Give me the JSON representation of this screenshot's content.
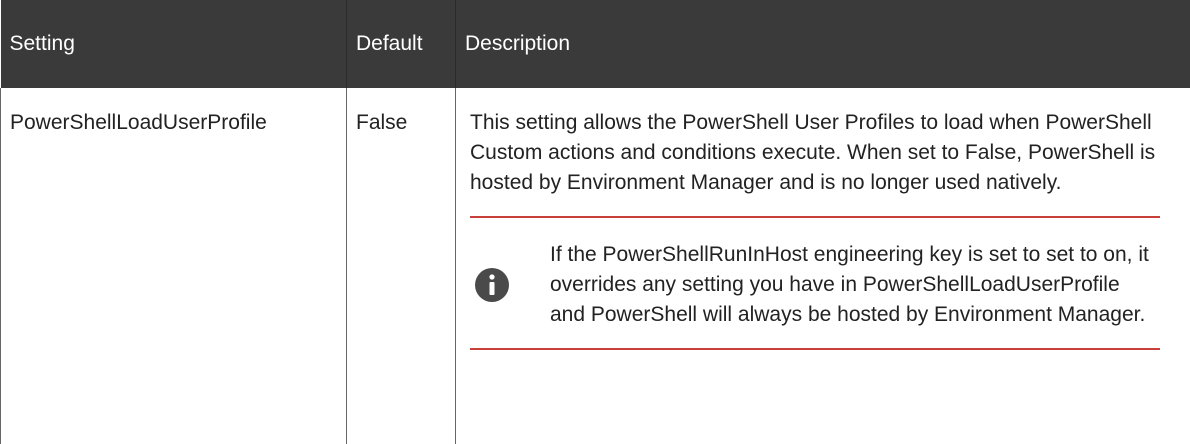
{
  "table": {
    "headers": {
      "setting": "Setting",
      "default": "Default",
      "description": "Description"
    },
    "row": {
      "setting": "PowerShellLoadUserProfile",
      "default": "False",
      "description": "This setting allows the PowerShell User Profiles to load when PowerShell Custom actions and conditions execute. When set to False, PowerShell is hosted by Environment Manager and is no longer used natively."
    },
    "note": {
      "icon": "info-icon",
      "text": "If the PowerShellRunInHost engineering key is set to set to on, it overrides any setting you have in PowerShellLoadUserProfile and PowerShell will always be hosted by Environment Manager."
    }
  },
  "colors": {
    "header_bg": "#3a3a3a",
    "header_text": "#ffffff",
    "note_rule": "#c9403a",
    "icon_fill": "#4a4a4a"
  }
}
